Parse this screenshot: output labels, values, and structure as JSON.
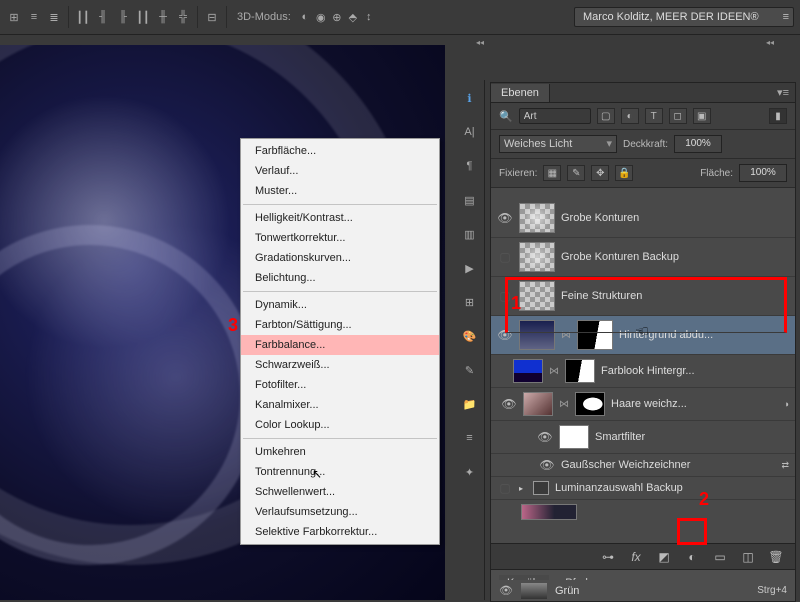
{
  "topbar": {
    "mode_label": "3D-Modus:",
    "workspace": "Marco Kolditz, MEER DER IDEEN®"
  },
  "context_menu": {
    "groups": [
      [
        "Farbfläche...",
        "Verlauf...",
        "Muster..."
      ],
      [
        "Helligkeit/Kontrast...",
        "Tonwertkorrektur...",
        "Gradationskurven...",
        "Belichtung..."
      ],
      [
        "Dynamik...",
        "Farbton/Sättigung...",
        "Farbbalance...",
        "Schwarzweiß...",
        "Fotofilter...",
        "Kanalmixer...",
        "Color Lookup..."
      ],
      [
        "Umkehren",
        "Tontrennung...",
        "Schwellenwert...",
        "Verlaufsumsetzung...",
        "Selektive Farbkorrektur..."
      ]
    ],
    "highlight": "Farbbalance..."
  },
  "panel": {
    "tab": "Ebenen",
    "search_placeholder": "Art",
    "blend_mode": "Weiches Licht",
    "opacity_label": "Deckkraft:",
    "opacity_value": "100%",
    "lock_label": "Fixieren:",
    "fill_label": "Fläche:",
    "fill_value": "100%"
  },
  "layers": [
    {
      "name": "Grobe Konturen",
      "visible": true
    },
    {
      "name": "Grobe Konturen Backup",
      "visible": false
    },
    {
      "name": "Feine Strukturen",
      "visible": false
    },
    {
      "name": "Hintergrund abdu...",
      "visible": true,
      "selected": true,
      "mask": true
    },
    {
      "name": "Farblook Hintergr...",
      "visible": true,
      "mask": true
    },
    {
      "name": "Haare weichz...",
      "visible": true,
      "mask": true,
      "fx": true
    },
    {
      "name": "Smartfilter",
      "sublabel": true
    },
    {
      "name": "Gaußscher Weichzeichner",
      "subfilter": true
    },
    {
      "name": "Luminanzauswahl Backup",
      "group": true
    }
  ],
  "channels": {
    "tab1": "Kanäle",
    "tab2": "Pfade",
    "channel": "Grün",
    "shortcut": "Strg+4"
  },
  "callouts": {
    "one": "1",
    "two": "2",
    "three": "3"
  }
}
